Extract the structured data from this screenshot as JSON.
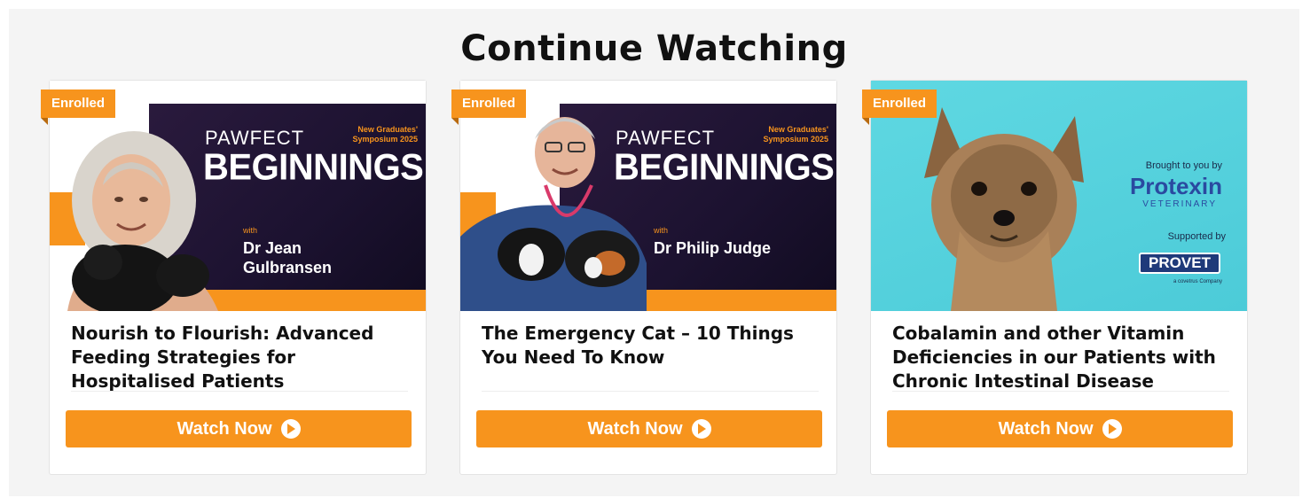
{
  "section": {
    "title": "Continue Watching"
  },
  "cards": [
    {
      "badge": "Enrolled",
      "thumbnail": {
        "series_line1": "PAWFECT",
        "series_line2": "BEGINNINGS",
        "event": "New Graduates' Symposium 2025",
        "with": "with",
        "speaker": "Dr Jean Gulbransen"
      },
      "title": "Nourish to Flourish: Advanced Feeding Strategies for Hospitalised Patients",
      "button": "Watch Now",
      "button_icon": "play-circle-icon"
    },
    {
      "badge": "Enrolled",
      "thumbnail": {
        "series_line1": "PAWFECT",
        "series_line2": "BEGINNINGS",
        "event": "New Graduates' Symposium 2025",
        "with": "with",
        "speaker": "Dr Philip Judge"
      },
      "title": "The Emergency Cat – 10 Things You Need To Know",
      "button": "Watch Now",
      "button_icon": "play-circle-icon"
    },
    {
      "badge": "Enrolled",
      "thumbnail": {
        "brought_by": "Brought to you by",
        "sponsor": "Protexin",
        "sponsor_sub": "VETERINARY",
        "supported_by": "Supported by",
        "supporter": "PROVET",
        "supporter_sub": "a covetrus Company"
      },
      "title": "Cobalamin and other Vitamin Deficiencies in our Patients with Chronic Intestinal Disease",
      "button": "Watch Now",
      "button_icon": "play-circle-icon"
    }
  ],
  "colors": {
    "accent": "#f7941d",
    "background": "#f4f4f4",
    "card": "#ffffff",
    "panel": "#1c1230",
    "teal": "#4ccbd8"
  }
}
